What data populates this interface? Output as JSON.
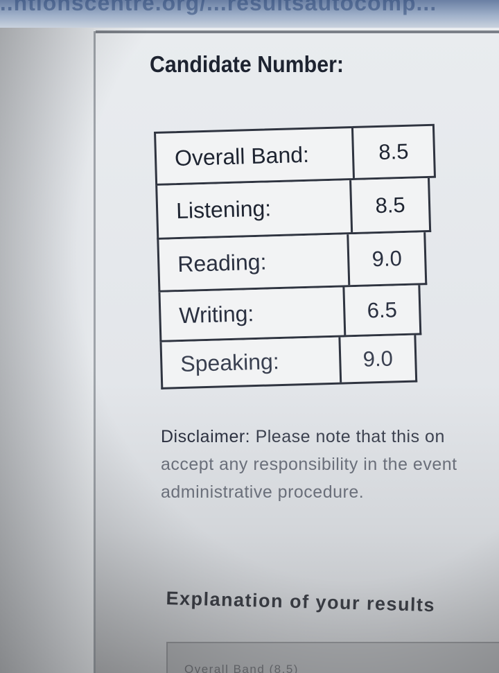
{
  "header": {
    "url_fragment": "...ntionscentre.org/...resultsautocomp..."
  },
  "candidate": {
    "label": "Candidate Number:"
  },
  "results": [
    {
      "label": "Overall Band:",
      "value": "8.5"
    },
    {
      "label": "Listening:",
      "value": "8.5"
    },
    {
      "label": "Reading:",
      "value": "9.0"
    },
    {
      "label": "Writing:",
      "value": "6.5"
    },
    {
      "label": "Speaking:",
      "value": "9.0"
    }
  ],
  "disclaimer": {
    "heading": "Disclaimer:",
    "line1": "Please note that this on",
    "line2": "accept any responsibility in the event",
    "line3": "administrative procedure."
  },
  "explanation": {
    "heading": "Explanation of your results",
    "overall_band_label": "Overall Band (8.5)"
  }
}
